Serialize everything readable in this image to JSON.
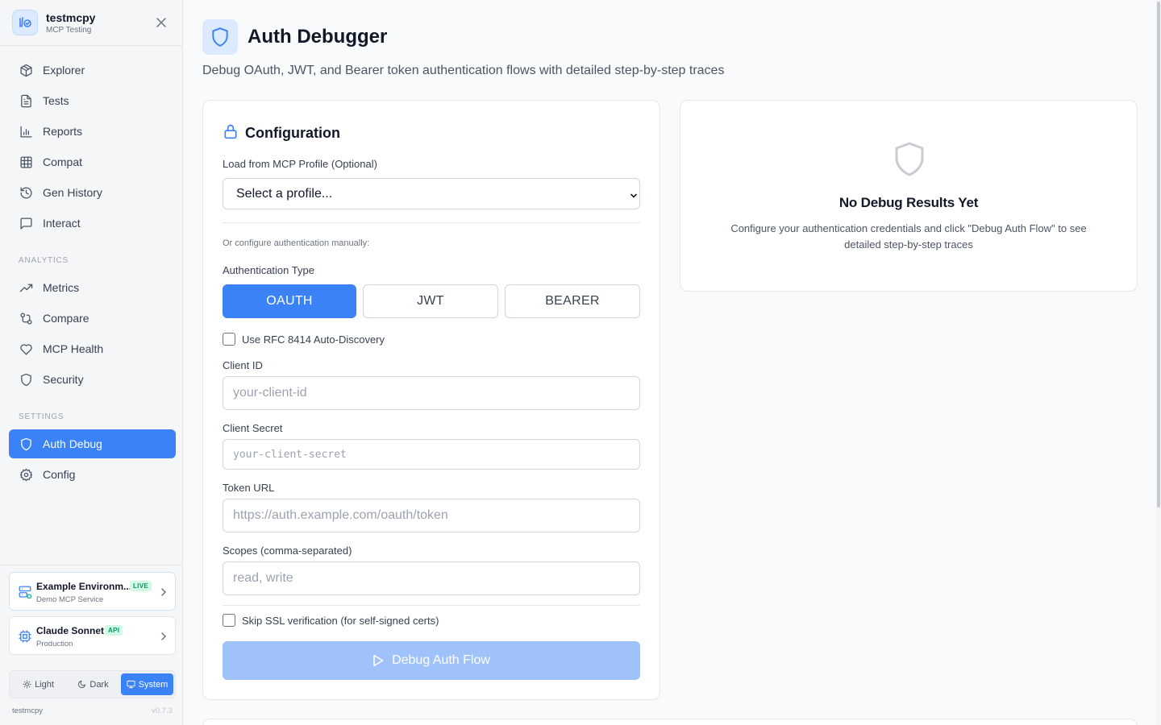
{
  "sidebar": {
    "app_name": "testmcpy",
    "app_subtitle": "MCP Testing",
    "nav": [
      {
        "label": "Explorer",
        "icon": "cube-icon"
      },
      {
        "label": "Tests",
        "icon": "file-text-icon"
      },
      {
        "label": "Reports",
        "icon": "bar-chart-icon"
      },
      {
        "label": "Compat",
        "icon": "grid-icon"
      },
      {
        "label": "Gen History",
        "icon": "history-icon"
      },
      {
        "label": "Interact",
        "icon": "message-square-icon"
      }
    ],
    "analytics_heading": "ANALYTICS",
    "analytics": [
      {
        "label": "Metrics",
        "icon": "trending-up-icon"
      },
      {
        "label": "Compare",
        "icon": "git-compare-icon"
      },
      {
        "label": "MCP Health",
        "icon": "heart-icon"
      },
      {
        "label": "Security",
        "icon": "shield-icon"
      }
    ],
    "settings_heading": "SETTINGS",
    "settings": [
      {
        "label": "Auth Debug",
        "icon": "shield-icon",
        "active": true
      },
      {
        "label": "Config",
        "icon": "gear-icon"
      }
    ],
    "environment": {
      "title": "Example Environm...",
      "badge": "LIVE",
      "subtitle": "Demo MCP Service"
    },
    "model": {
      "title": "Claude Sonnet",
      "badge": "API",
      "subtitle": "Production"
    },
    "theme": {
      "light": "Light",
      "dark": "Dark",
      "system": "System",
      "selected": "System"
    },
    "footer_name": "testmcpy",
    "version": "v0.7.3"
  },
  "page": {
    "title": "Auth Debugger",
    "description": "Debug OAuth, JWT, and Bearer token authentication flows with detailed step-by-step traces"
  },
  "config": {
    "title": "Configuration",
    "profile_label": "Load from MCP Profile (Optional)",
    "profile_selected": "Select a profile...",
    "manual_hint": "Or configure authentication manually:",
    "auth_type_label": "Authentication Type",
    "auth_types": [
      "OAUTH",
      "JWT",
      "BEARER"
    ],
    "auth_type_selected": "OAUTH",
    "rfc_discovery_label": "Use RFC 8414 Auto-Discovery",
    "client_id_label": "Client ID",
    "client_id_placeholder": "your-client-id",
    "client_secret_label": "Client Secret",
    "client_secret_placeholder": "your-client-secret",
    "token_url_label": "Token URL",
    "token_url_placeholder": "https://auth.example.com/oauth/token",
    "scopes_label": "Scopes (comma-separated)",
    "scopes_placeholder": "read, write",
    "skip_ssl_label": "Skip SSL verification (for self-signed certs)",
    "debug_button": "Debug Auth Flow"
  },
  "results": {
    "title": "No Debug Results Yet",
    "description": "Configure your authentication credentials and click \"Debug Auth Flow\" to see detailed step-by-step traces"
  },
  "colors": {
    "accent": "#3b82f6",
    "accent_disabled": "#9ec2f9",
    "badge_green_bg": "#d1fae5",
    "badge_green_text": "#059669"
  }
}
